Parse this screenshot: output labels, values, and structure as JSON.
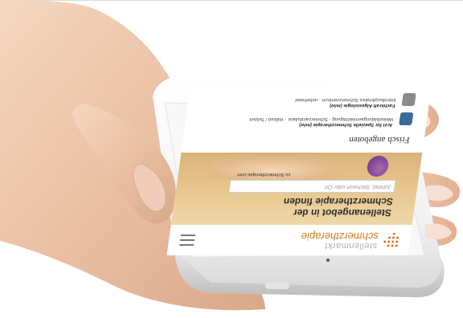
{
  "phone_screen": {
    "logo_line1": "stellenmarkt",
    "logo_line2": "schmerztherapie",
    "banner_title": "Stellenangebot in der Schmerztherapie finden",
    "search_placeholder": "Jobtitel, Stichwort oder Ort",
    "banner_link": "zu Schmerztherapie.com",
    "section_title": "Frisch angeboten",
    "items": [
      {
        "title": "Arzt für Spezielle Schmerztherapie (m/w)",
        "text": "Weiterbildungsermächtigung · Schmerzambulanz · Vollzeit / Teilzeit"
      },
      {
        "title": "Fachkraft Algesiologie (m/w)",
        "text": "Interdisziplinäres Schmerzzentrum · unbefristet"
      }
    ]
  },
  "colors": {
    "brand_orange": "#d77a22",
    "banner_bg": "#e6c48b",
    "accent_purple": "#7e3d8c"
  }
}
